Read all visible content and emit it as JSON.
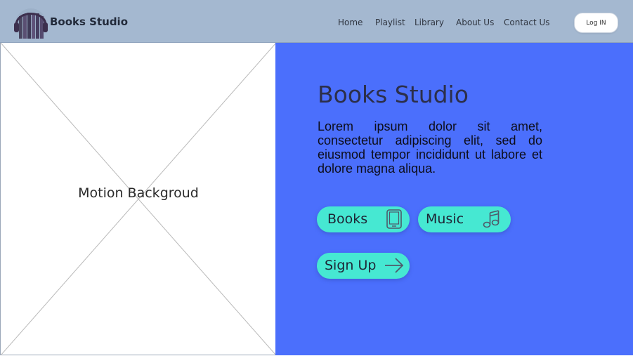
{
  "header": {
    "brand": "Books Studio",
    "nav": {
      "home": "Home",
      "playlist": "Playlist",
      "library": "Library",
      "about": "About Us",
      "contact": "Contact Us"
    },
    "login_label": "Log IN"
  },
  "media": {
    "label": "Motion Backgroud"
  },
  "hero": {
    "title": "Books Studio",
    "body": "Lorem ipsum dolor sit amet, consectetur adipiscing elit, sed do eiusmod tempor incididunt ut labore et dolore magna aliqua.",
    "buttons": {
      "books": "Books",
      "music": "Music",
      "signup": "Sign Up"
    }
  },
  "icons": {
    "logo": "headphones-books-logo",
    "books": "tablet-book-icon",
    "music": "music-note-icon",
    "signup": "arrow-right-icon"
  },
  "colors": {
    "header_bg": "#a4b8d0",
    "hero_bg": "#4b6ffc",
    "pill_bg": "#46e8d2"
  }
}
